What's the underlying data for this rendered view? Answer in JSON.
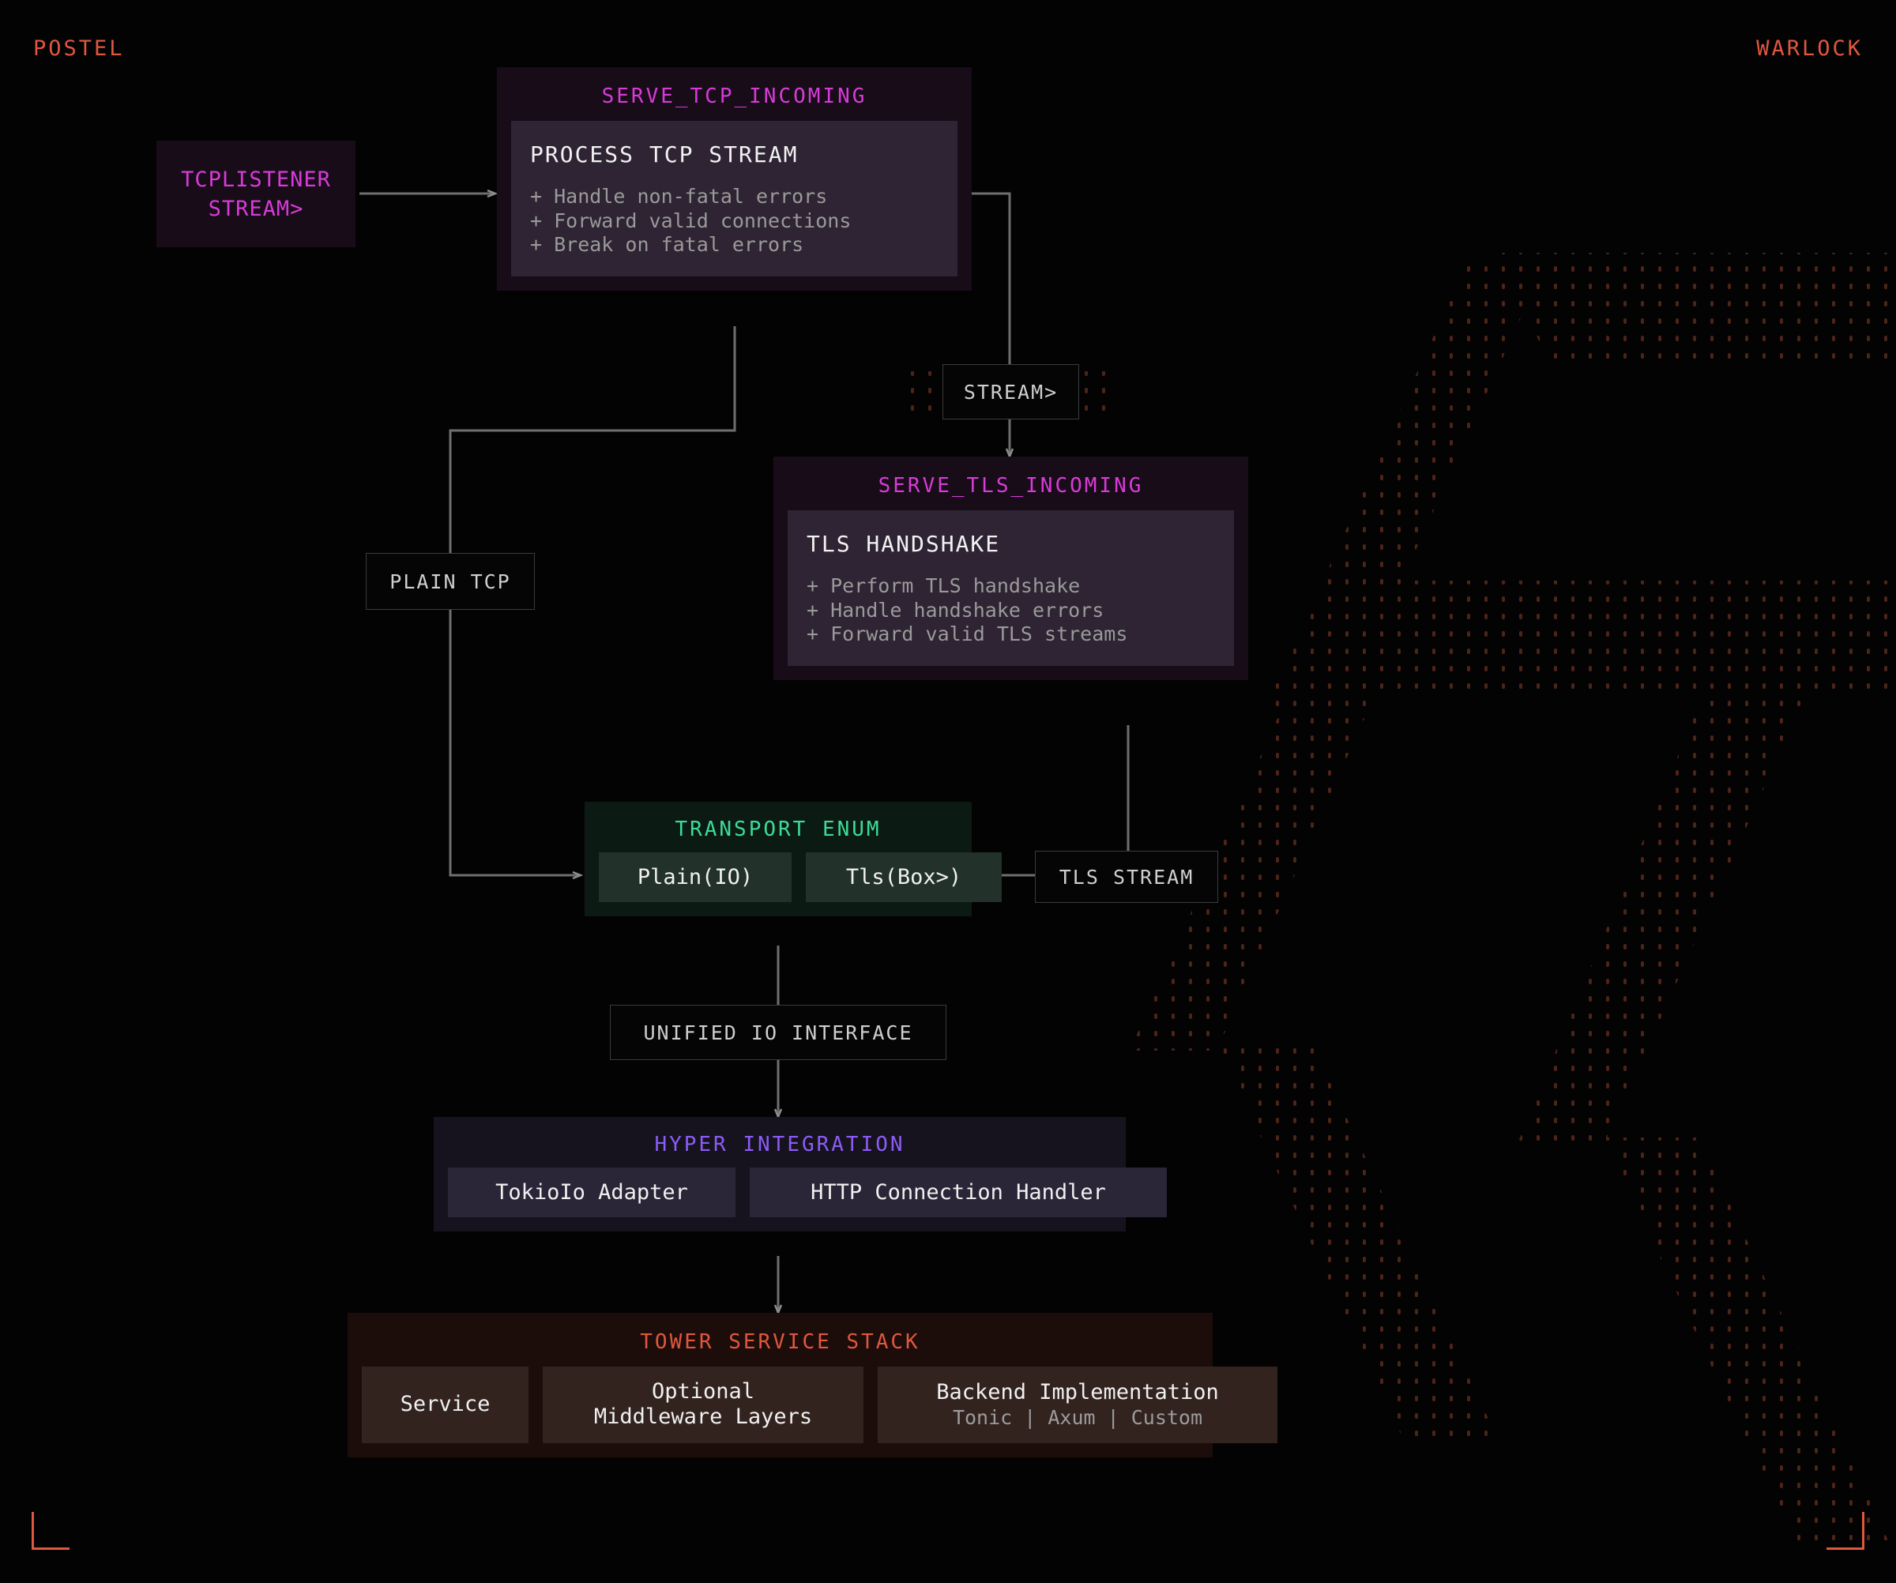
{
  "brand": {
    "left": "POSTEL",
    "right": "WARLOCK",
    "accent": "#e0573f"
  },
  "colors": {
    "background": "#030303",
    "magenta": "#d83bd8",
    "green": "#3ddc97",
    "violet": "#8b5cf6",
    "orange": "#e0573f",
    "wire": "#6f6f6f",
    "muted_text": "#9a9a9a"
  },
  "nodes": {
    "tcp_listener": {
      "line1": "TCPLISTENER",
      "line2": "STREAM>"
    },
    "serve_tcp": {
      "title": "SERVE_TCP_INCOMING",
      "body_head": "PROCESS TCP STREAM",
      "bullets": [
        "+ Handle non-fatal errors",
        "+ Forward valid connections",
        "+ Break on fatal errors"
      ]
    },
    "stream_label": {
      "text": "STREAM>"
    },
    "plain_tcp_label": {
      "text": "PLAIN TCP"
    },
    "serve_tls": {
      "title": "SERVE_TLS_INCOMING",
      "body_head": "TLS HANDSHAKE",
      "bullets": [
        "+ Perform TLS handshake",
        "+ Handle handshake errors",
        "+ Forward valid TLS streams"
      ]
    },
    "tls_stream_label": {
      "text": "TLS STREAM"
    },
    "transport_enum": {
      "title": "TRANSPORT ENUM",
      "variants": [
        "Plain(IO)",
        "Tls(Box>)"
      ]
    },
    "unified_io_label": {
      "text": "UNIFIED IO INTERFACE"
    },
    "hyper": {
      "title": "HYPER INTEGRATION",
      "items": [
        "TokioIo Adapter",
        "HTTP Connection Handler"
      ]
    },
    "tower": {
      "title": "TOWER SERVICE STACK",
      "items": [
        {
          "main": "Service",
          "sub": ""
        },
        {
          "main": "Optional",
          "sub": "Middleware Layers"
        },
        {
          "main": "Backend Implementation",
          "sub": "Tonic | Axum | Custom"
        }
      ]
    }
  }
}
